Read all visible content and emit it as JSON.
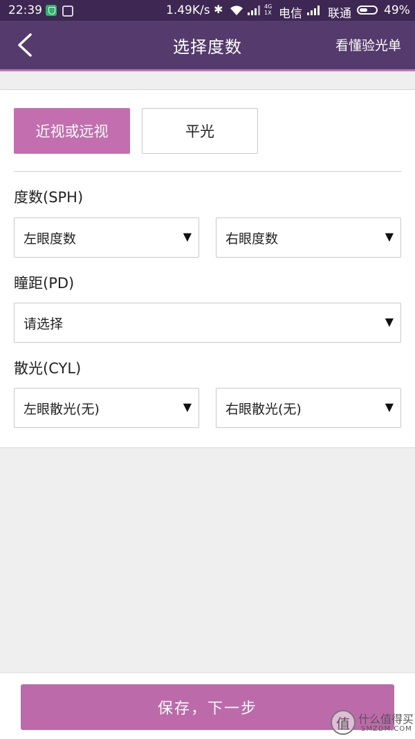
{
  "status_bar": {
    "time": "22:39",
    "speed": "1.49K/s",
    "network_type": "4G\n1X",
    "carrier1": "电信",
    "carrier2": "联通",
    "battery_pct": "49%",
    "battery_level": 0.49
  },
  "nav": {
    "title": "选择度数",
    "right_link": "看懂验光单"
  },
  "toggle": {
    "option1": "近视或远视",
    "option2": "平光",
    "selected": "option1"
  },
  "sph": {
    "label": "度数(SPH)",
    "left": "左眼度数",
    "right": "右眼度数"
  },
  "pd": {
    "label": "瞳距(PD)",
    "value": "请选择"
  },
  "cyl": {
    "label": "散光(CYL)",
    "left": "左眼散光(无)",
    "right": "右眼散光(无)"
  },
  "footer": {
    "save_label": "保存，下一步"
  },
  "watermark": {
    "logo_char": "值",
    "text": "什么值得买",
    "sub": "SMZDM.COM"
  },
  "colors": {
    "status_bar": "#3f2753",
    "nav_bar": "#553a6e",
    "accent": "#c573b6",
    "button": "#bc6aaa"
  },
  "icons": {
    "arrow": "▼"
  }
}
